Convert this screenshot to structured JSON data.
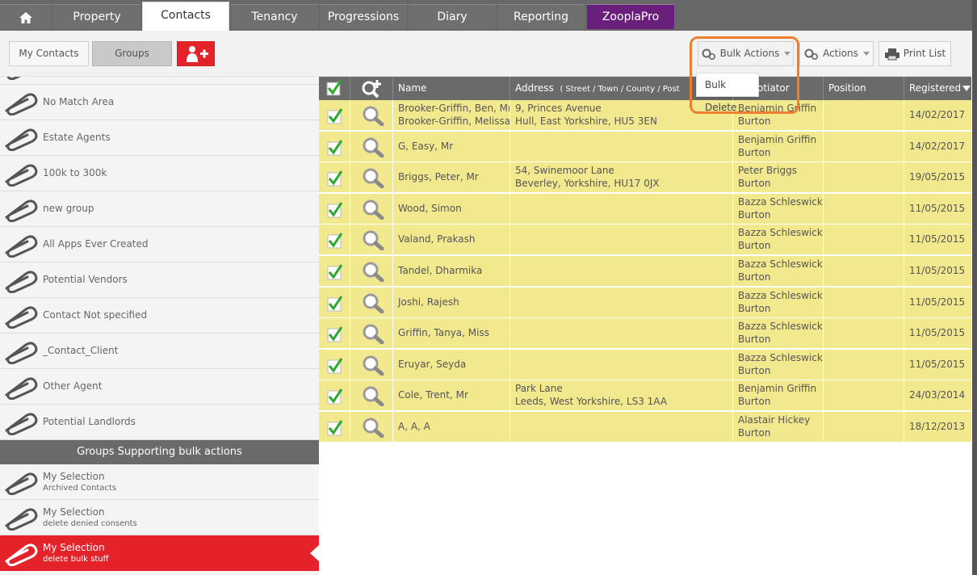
{
  "nav": {
    "tabs": [
      {
        "label": "Property"
      },
      {
        "label": "Contacts"
      },
      {
        "label": "Tenancy"
      },
      {
        "label": "Progressions"
      },
      {
        "label": "Diary"
      },
      {
        "label": "Reporting"
      },
      {
        "label": "ZooplaPro"
      }
    ]
  },
  "toolbar": {
    "my_contacts": "My Contacts",
    "groups": "Groups",
    "bulk_actions": "Bulk Actions",
    "actions": "Actions",
    "print_list": "Print List"
  },
  "dropdown": {
    "bulk_delete": "Bulk Delete"
  },
  "sidebar": {
    "groups": [
      {
        "label": "No Match Area"
      },
      {
        "label": "Estate Agents"
      },
      {
        "label": "100k to 300k"
      },
      {
        "label": "new group"
      },
      {
        "label": "All Apps Ever Created"
      },
      {
        "label": "Potential Vendors"
      },
      {
        "label": "Contact Not specified"
      },
      {
        "label": "_Contact_Client"
      },
      {
        "label": "Other Agent"
      },
      {
        "label": "Potential Landlords"
      }
    ],
    "section_header": "Groups Supporting bulk actions",
    "bulk_groups": [
      {
        "label": "My Selection",
        "sub": "Archived Contacts"
      },
      {
        "label": "My Selection",
        "sub": "delete denied consents"
      },
      {
        "label": "My Selection",
        "sub": "delete bulk stuff"
      }
    ]
  },
  "table": {
    "headers": {
      "name": "Name",
      "address": "Address",
      "address_parts": "( Street / Town / County / Post",
      "negotiator": "Negotiator",
      "position": "Position",
      "registered": "Registered"
    },
    "rows": [
      {
        "name1": "Brooker-Griffin, Ben, Mr",
        "name2": "Brooker-Griffin, Melissa, Mrs",
        "addr1": "9, Princes Avenue",
        "addr2": "Hull, East Yorkshire, HU5 3EN",
        "neg1": "Benjamin Griffin",
        "neg2": "Burton",
        "position": "",
        "registered": "14/02/2017"
      },
      {
        "name1": "G, Easy, Mr",
        "name2": "",
        "addr1": "",
        "addr2": "",
        "neg1": "Benjamin Griffin",
        "neg2": "Burton",
        "position": "",
        "registered": "14/02/2017"
      },
      {
        "name1": "Briggs, Peter, Mr",
        "name2": "",
        "addr1": "54, Swinemoor Lane",
        "addr2": "Beverley, Yorkshire, HU17 0JX",
        "neg1": "Peter Briggs",
        "neg2": "Burton",
        "position": "",
        "registered": "19/05/2015"
      },
      {
        "name1": "Wood, Simon",
        "name2": "",
        "addr1": "",
        "addr2": "",
        "neg1": "Bazza Schleswick",
        "neg2": "Burton",
        "position": "",
        "registered": "11/05/2015"
      },
      {
        "name1": "Valand, Prakash",
        "name2": "",
        "addr1": "",
        "addr2": "",
        "neg1": "Bazza Schleswick",
        "neg2": "Burton",
        "position": "",
        "registered": "11/05/2015"
      },
      {
        "name1": "Tandel, Dharmika",
        "name2": "",
        "addr1": "",
        "addr2": "",
        "neg1": "Bazza Schleswick",
        "neg2": "Burton",
        "position": "",
        "registered": "11/05/2015"
      },
      {
        "name1": "Joshi, Rajesh",
        "name2": "",
        "addr1": "",
        "addr2": "",
        "neg1": "Bazza Schleswick",
        "neg2": "Burton",
        "position": "",
        "registered": "11/05/2015"
      },
      {
        "name1": "Griffin, Tanya, Miss",
        "name2": "",
        "addr1": "",
        "addr2": "",
        "neg1": "Bazza Schleswick",
        "neg2": "Burton",
        "position": "",
        "registered": "11/05/2015"
      },
      {
        "name1": "Eruyar, Seyda",
        "name2": "",
        "addr1": "",
        "addr2": "",
        "neg1": "Bazza Schleswick",
        "neg2": "Burton",
        "position": "",
        "registered": "11/05/2015"
      },
      {
        "name1": "Cole, Trent, Mr",
        "name2": "",
        "addr1": "Park Lane",
        "addr2": "Leeds, West Yorkshire, LS3 1AA",
        "neg1": "Benjamin Griffin",
        "neg2": "Burton",
        "position": "",
        "registered": "24/03/2014"
      },
      {
        "name1": "A, A, A",
        "name2": "",
        "addr1": "",
        "addr2": "",
        "neg1": "Alastair Hickey",
        "neg2": "Burton",
        "position": "",
        "registered": "18/12/2013"
      }
    ]
  },
  "colors": {
    "nav_bg": "#686868",
    "accent_red": "#e5222a",
    "zoopla_purple": "#6b1f7c",
    "row_yellow": "#f2e88e",
    "highlight_orange": "#ef7f2f",
    "check_green": "#2fa82f"
  },
  "icons": [
    "home-icon",
    "add-group-icon",
    "gear-icon",
    "printer-icon",
    "paperclip-icon",
    "checkbox-icon",
    "magnifier-icon",
    "add-search-icon"
  ]
}
